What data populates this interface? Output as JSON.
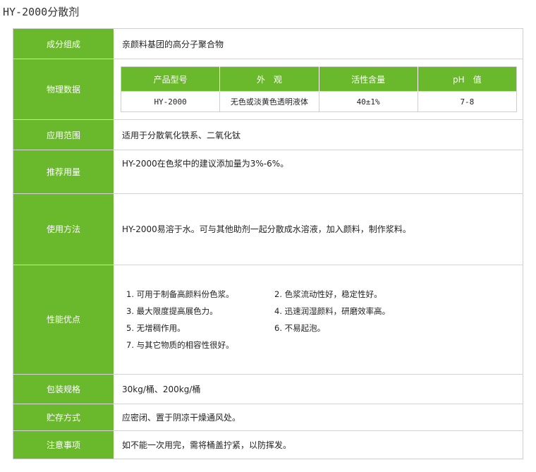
{
  "page_title": "HY-2000分散剂",
  "rows": {
    "composition": {
      "label": "成分组成",
      "value": "亲颜料基团的高分子聚合物"
    },
    "physical": {
      "label": "物理数据",
      "headers": [
        "产品型号",
        "外　观",
        "活性含量",
        "pH　值"
      ],
      "cells": [
        "HY-2000",
        "无色或淡黄色透明液体",
        "40±1%",
        "7-8"
      ]
    },
    "application": {
      "label": "应用范围",
      "value": "适用于分散氧化铁系、二氧化钛"
    },
    "dosage": {
      "label": "推荐用量",
      "value": "HY-2000在色浆中的建议添加量为3%-6%。"
    },
    "usage": {
      "label": "使用方法",
      "value": "HY-2000易溶于水。可与其他助剂一起分散成水溶液，加入颜料，制作浆料。"
    },
    "advantages": {
      "label": "性能优点",
      "items": [
        "1. 可用于制备高颜料份色浆。",
        "2. 色浆流动性好，稳定性好。",
        "3. 最大限度提高展色力。",
        "4. 迅速润湿颜料，研磨效率高。",
        "5. 无增稠作用。",
        "6. 不易起泡。",
        "7. 与其它物质的相容性很好。"
      ]
    },
    "packaging": {
      "label": "包装规格",
      "value": "30kg/桶、200kg/桶"
    },
    "storage": {
      "label": "贮存方式",
      "value": "应密闭、置于阴凉干燥通风处。"
    },
    "notes": {
      "label": "注意事项",
      "value": "如不能一次用完，需将桶盖拧紧，以防挥发。"
    }
  },
  "colors": {
    "accent_green": "#6ab82b",
    "border": "#cfcfcf"
  }
}
